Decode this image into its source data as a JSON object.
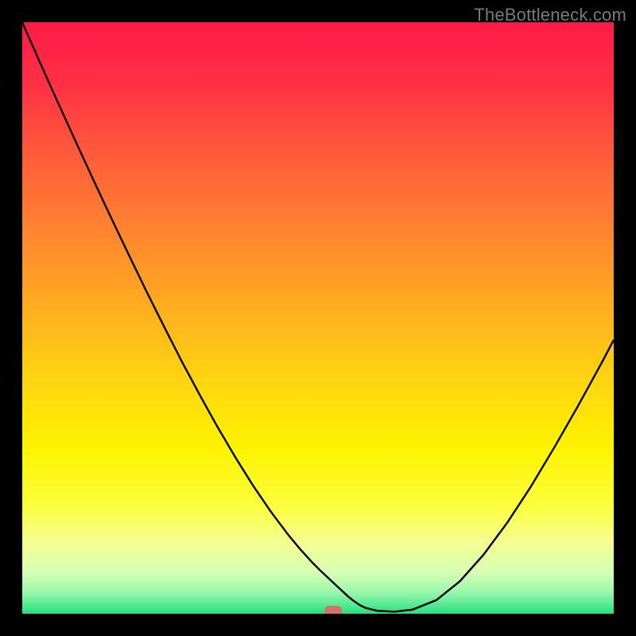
{
  "watermark": {
    "text": "TheBottleneck.com"
  },
  "chart_data": {
    "type": "line",
    "title": "",
    "xlabel": "",
    "ylabel": "",
    "xlim": [
      0,
      100
    ],
    "ylim": [
      0,
      100
    ],
    "grid": false,
    "legend": false,
    "background_gradient": {
      "stops": [
        {
          "offset": 0.0,
          "color": "#ff1a47"
        },
        {
          "offset": 0.1,
          "color": "#ff2f44"
        },
        {
          "offset": 0.22,
          "color": "#ff5a3b"
        },
        {
          "offset": 0.35,
          "color": "#ff8330"
        },
        {
          "offset": 0.5,
          "color": "#ffb31e"
        },
        {
          "offset": 0.62,
          "color": "#ffd90f"
        },
        {
          "offset": 0.72,
          "color": "#fff300"
        },
        {
          "offset": 0.82,
          "color": "#fbff3f"
        },
        {
          "offset": 0.88,
          "color": "#f3ff92"
        },
        {
          "offset": 0.93,
          "color": "#d6ffb4"
        },
        {
          "offset": 0.965,
          "color": "#97f7ac"
        },
        {
          "offset": 1.0,
          "color": "#26e07f"
        }
      ]
    },
    "series": [
      {
        "name": "bottleneck-curve",
        "color": "#000000",
        "stroke_width": 2.4,
        "x": [
          0,
          3,
          6,
          9,
          12,
          15,
          18,
          21,
          24,
          27,
          30,
          33,
          36,
          39,
          42,
          45,
          47,
          49,
          50.5,
          52,
          53.5,
          55,
          56,
          57,
          58,
          60,
          63,
          66,
          70,
          74,
          78,
          82,
          86,
          90,
          94,
          98,
          100
        ],
        "y": [
          100,
          93.2,
          86.5,
          79.9,
          73.4,
          67.0,
          60.7,
          54.5,
          48.5,
          42.6,
          37.0,
          31.6,
          26.5,
          21.7,
          17.3,
          13.3,
          10.9,
          8.7,
          7.2,
          5.8,
          4.4,
          3.0,
          2.2,
          1.5,
          1.0,
          0.5,
          0.35,
          0.7,
          2.3,
          5.5,
          10.0,
          15.4,
          21.5,
          28.2,
          35.2,
          42.5,
          46.3
        ]
      }
    ],
    "marker": {
      "x": 52.5,
      "y": 0.5,
      "color": "#d6706f"
    },
    "annotations": []
  }
}
